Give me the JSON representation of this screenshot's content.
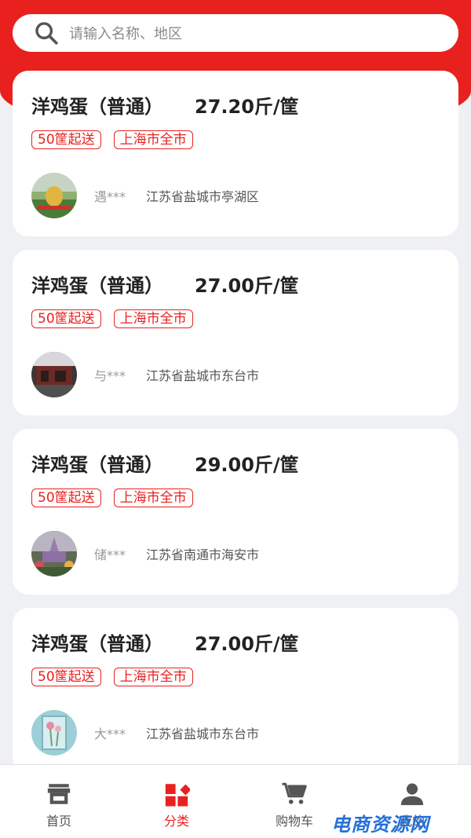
{
  "search": {
    "placeholder": "请输入名称、地区"
  },
  "listings": [
    {
      "title": "洋鸡蛋（普通）",
      "price": "27.20斤/筐",
      "tags": [
        "50筐起送",
        "上海市全市"
      ],
      "seller": "遇***",
      "location": "江苏省盐城市亭湖区"
    },
    {
      "title": "洋鸡蛋（普通）",
      "price": "27.00斤/筐",
      "tags": [
        "50筐起送",
        "上海市全市"
      ],
      "seller": "与***",
      "location": "江苏省盐城市东台市"
    },
    {
      "title": "洋鸡蛋（普通）",
      "price": "29.00斤/筐",
      "tags": [
        "50筐起送",
        "上海市全市"
      ],
      "seller": "储***",
      "location": "江苏省南通市海安市"
    },
    {
      "title": "洋鸡蛋（普通）",
      "price": "27.00斤/筐",
      "tags": [
        "50筐起送",
        "上海市全市"
      ],
      "seller": "大***",
      "location": "江苏省盐城市东台市"
    }
  ],
  "tabbar": {
    "items": [
      {
        "label": "首页",
        "icon": "store-icon"
      },
      {
        "label": "分类",
        "icon": "category-icon",
        "active": true
      },
      {
        "label": "购物车",
        "icon": "cart-icon"
      },
      {
        "label": "我的",
        "icon": "user-icon"
      }
    ]
  },
  "watermark": "电商资源网",
  "colors": {
    "accent": "#e8211f",
    "background": "#eef0f4",
    "watermark": "#2670d8"
  }
}
